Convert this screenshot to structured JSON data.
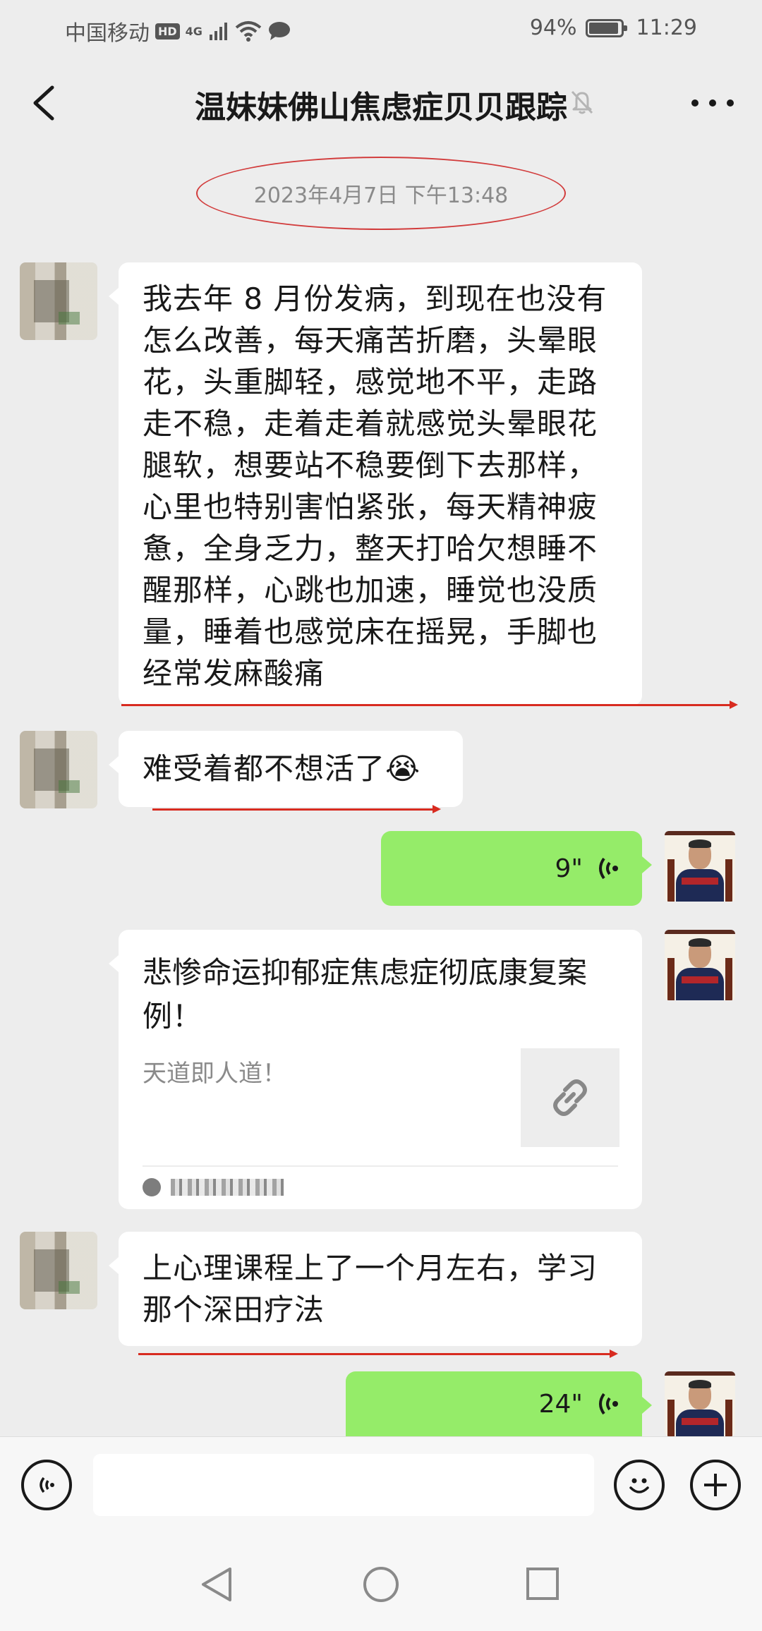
{
  "status_bar": {
    "carrier": "中国移动",
    "hd": "HD",
    "network": "4G",
    "battery_percent": "94%",
    "battery_level": 0.94,
    "time": "11:29"
  },
  "header": {
    "title": "温妹妹佛山焦虑症贝贝跟踪",
    "muted": true
  },
  "chat": {
    "timestamp": "2023年4月7日 下午13:48",
    "messages": [
      {
        "id": "m1",
        "direction": "in",
        "type": "text",
        "lines": [
          "我去年 8 月份发病，到现在也没有",
          "怎么改善，每天痛苦折磨，头晕眼",
          "花，头重脚轻，感觉地不平，走路",
          "走不稳，走着走着就感觉头晕眼花",
          "腿软，想要站不稳要倒下去那样，",
          "心里也特别害怕紧张，每天精神疲",
          "惫，全身乏力，整天打哈欠想睡不",
          "醒那样，心跳也加速，睡觉也没质",
          "量，睡着也感觉床在摇晃，手脚也",
          "经常发麻酸痛"
        ]
      },
      {
        "id": "m2",
        "direction": "in",
        "type": "text",
        "text": "难受着都不想活了",
        "emoji": "😭"
      },
      {
        "id": "m3",
        "direction": "out",
        "type": "voice",
        "duration": "9\""
      },
      {
        "id": "m4",
        "direction": "out",
        "type": "link",
        "title_lines": [
          "悲惨命运抑郁症焦虑症彻底康复案",
          "例！"
        ],
        "description": "天道即人道！"
      },
      {
        "id": "m5",
        "direction": "in",
        "type": "text",
        "lines": [
          "上心理课程上了一个月左右，学习",
          "那个深田疗法"
        ]
      },
      {
        "id": "m6",
        "direction": "out",
        "type": "voice",
        "duration": "24\""
      }
    ]
  },
  "input_bar": {
    "placeholder": ""
  },
  "colors": {
    "background": "#ededed",
    "bubble_in": "#ffffff",
    "bubble_out": "#95ec69",
    "annotation_red": "#d82b20"
  },
  "icons": [
    "back-icon",
    "mute-icon",
    "more-icon",
    "voice-wave-icon",
    "link-icon",
    "voice-mode-icon",
    "emoji-icon",
    "plus-icon",
    "nav-back-icon",
    "nav-home-icon",
    "nav-recents-icon"
  ]
}
